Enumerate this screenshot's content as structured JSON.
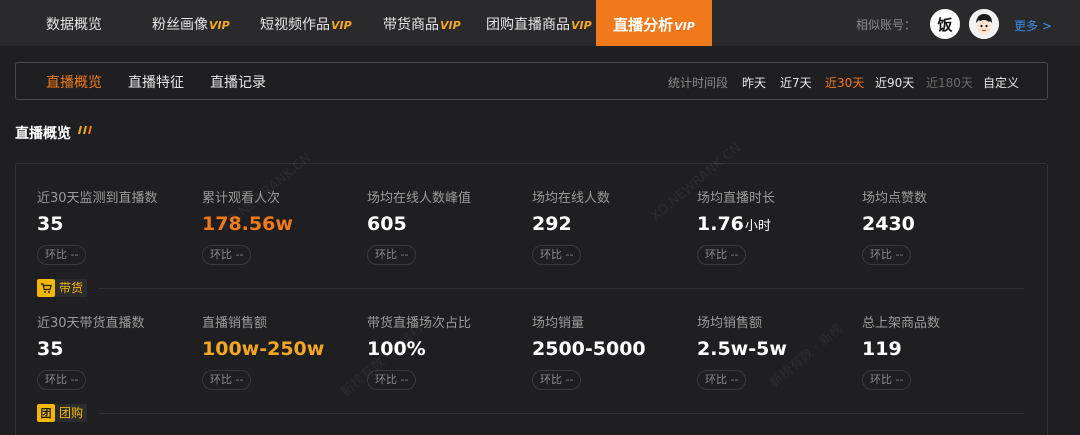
{
  "topnav": {
    "tabs": [
      {
        "label": "数据概览",
        "vip": ""
      },
      {
        "label": "粉丝画像",
        "vip": "VIP"
      },
      {
        "label": "短视频作品",
        "vip": "VIP"
      },
      {
        "label": "带货商品",
        "vip": "VIP"
      },
      {
        "label": "团购直播商品",
        "vip": "VIP"
      },
      {
        "label": "直播分析",
        "vip": "VIP"
      }
    ],
    "similar_label": "相似账号：",
    "avatar1_text": "饭",
    "more_label": "更多 >"
  },
  "subnav": {
    "tabs": [
      "直播概览",
      "直播特征",
      "直播记录"
    ],
    "period_label": "统计时间段",
    "periods": [
      "昨天",
      "近7天",
      "近30天",
      "近90天",
      "近180天",
      "自定义"
    ]
  },
  "section": {
    "title": "直播概览"
  },
  "overview": [
    {
      "label": "近30天监测到直播数",
      "value": "35",
      "unit": "",
      "badge": "环比 --"
    },
    {
      "label": "累计观看人次",
      "value": "178.56w",
      "unit": "",
      "badge": "环比 --"
    },
    {
      "label": "场均在线人数峰值",
      "value": "605",
      "unit": "",
      "badge": "环比 --"
    },
    {
      "label": "场均在线人数",
      "value": "292",
      "unit": "",
      "badge": "环比 --"
    },
    {
      "label": "场均直播时长",
      "value": "1.76",
      "unit": "小时",
      "badge": "环比 --"
    },
    {
      "label": "场均点赞数",
      "value": "2430",
      "unit": "",
      "badge": "环比 --"
    }
  ],
  "sales_tag": {
    "icon": "cart-icon",
    "label": "带货"
  },
  "sales": [
    {
      "label": "近30天带货直播数",
      "value": "35",
      "badge": "环比 --"
    },
    {
      "label": "直播销售额",
      "value": "100w-250w",
      "badge": "环比 --"
    },
    {
      "label": "带货直播场次占比",
      "value": "100%",
      "badge": "环比 --"
    },
    {
      "label": "场均销量",
      "value": "2500-5000",
      "badge": "环比 --"
    },
    {
      "label": "场均销售额",
      "value": "2.5w-5w",
      "badge": "环比 --"
    },
    {
      "label": "总上架商品数",
      "value": "119",
      "badge": "环比 --"
    }
  ],
  "group_tag": {
    "icon_text": "团",
    "label": "团购"
  },
  "watermarks": [
    "XD.NEWRANK.CN",
    "新榜有数 · 新榜",
    "新榜有数 · 新榜科"
  ],
  "colors": {
    "accent": "#f07a1b",
    "vip": "#f5a623",
    "tag": "#f5b800",
    "link": "#3a8ee6"
  }
}
